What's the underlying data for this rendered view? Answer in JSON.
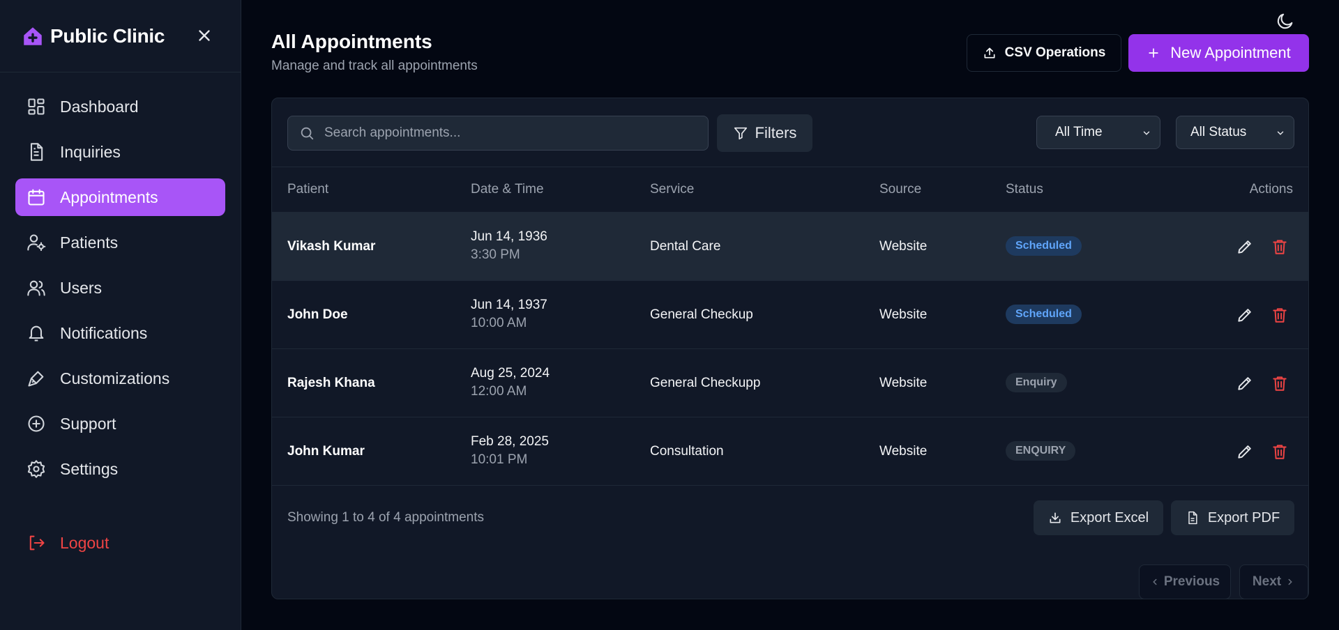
{
  "sidebar": {
    "brand": "Public Clinic",
    "items": [
      {
        "label": "Dashboard",
        "icon": "dashboard-icon"
      },
      {
        "label": "Inquiries",
        "icon": "document-icon"
      },
      {
        "label": "Appointments",
        "icon": "calendar-icon",
        "active": true
      },
      {
        "label": "Patients",
        "icon": "user-gear-icon"
      },
      {
        "label": "Users",
        "icon": "users-icon"
      },
      {
        "label": "Notifications",
        "icon": "bell-icon"
      },
      {
        "label": "Customizations",
        "icon": "brush-icon"
      },
      {
        "label": "Support",
        "icon": "plus-circle-icon"
      },
      {
        "label": "Settings",
        "icon": "gear-icon"
      }
    ],
    "logout": "Logout"
  },
  "header": {
    "title": "All Appointments",
    "subtitle": "Manage and track all appointments",
    "csv_label": "CSV Operations",
    "new_label": "New Appointment"
  },
  "toolbar": {
    "search_placeholder": "Search appointments...",
    "filters_label": "Filters",
    "time_filter": "All Time",
    "status_filter": "All Status"
  },
  "table": {
    "columns": [
      "Patient",
      "Date & Time",
      "Service",
      "Source",
      "Status",
      "Actions"
    ],
    "rows": [
      {
        "patient": "Vikash Kumar",
        "date": "Jun 14, 1936",
        "time": "3:30 PM",
        "service": "Dental Care",
        "source": "Website",
        "status": "Scheduled",
        "status_kind": "scheduled"
      },
      {
        "patient": "John Doe",
        "date": "Jun 14, 1937",
        "time": "10:00 AM",
        "service": "General Checkup",
        "source": "Website",
        "status": "Scheduled",
        "status_kind": "scheduled"
      },
      {
        "patient": "Rajesh Khana",
        "date": "Aug 25, 2024",
        "time": "12:00 AM",
        "service": "General Checkupp",
        "source": "Website",
        "status": "Enquiry",
        "status_kind": "enquiry"
      },
      {
        "patient": "John Kumar",
        "date": "Feb 28, 2025",
        "time": "10:01 PM",
        "service": "Consultation",
        "source": "Website",
        "status": "ENQUIRY",
        "status_kind": "enquiry"
      }
    ]
  },
  "footer": {
    "showing": "Showing 1 to 4 of 4 appointments",
    "export_excel": "Export Excel",
    "export_pdf": "Export PDF",
    "previous": "Previous",
    "next": "Next"
  },
  "colors": {
    "accent": "#a855f7",
    "primary_button": "#9333ea",
    "danger": "#ef4444",
    "scheduled": "#60a5fa",
    "background": "#030712",
    "panel": "#111827"
  }
}
